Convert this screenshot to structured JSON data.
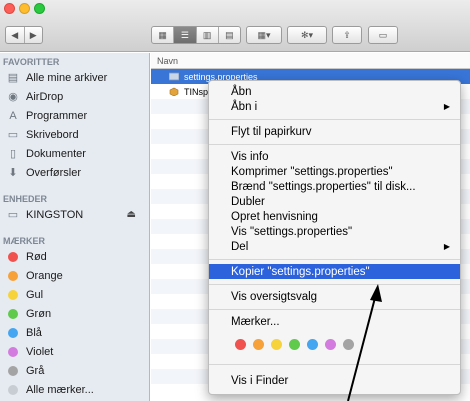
{
  "toolbar": {
    "back_icon": "◀",
    "forward_icon": "▶",
    "view_icons": [
      "▦",
      "☰",
      "▥",
      "▤"
    ],
    "arrange_icon": "▦▾",
    "action_icon": "✻▾",
    "share_icon": "⇪",
    "tag_icon": "▭"
  },
  "sidebar": {
    "favorites_header": "FAVORITTER",
    "favorites": [
      {
        "label": "Alle mine arkiver",
        "icon": "▤"
      },
      {
        "label": "AirDrop",
        "icon": "◉"
      },
      {
        "label": "Programmer",
        "icon": "A"
      },
      {
        "label": "Skrivebord",
        "icon": "▭"
      },
      {
        "label": "Dokumenter",
        "icon": "▯"
      },
      {
        "label": "Overførsler",
        "icon": "⬇"
      }
    ],
    "devices_header": "ENHEDER",
    "devices": [
      {
        "label": "KINGSTON",
        "icon": "▭",
        "eject": "⏏"
      }
    ],
    "tags_header": "MÆRKER",
    "tags": [
      {
        "label": "Rød",
        "color": "#f0524f"
      },
      {
        "label": "Orange",
        "color": "#f6a13a"
      },
      {
        "label": "Gul",
        "color": "#f7d33b"
      },
      {
        "label": "Grøn",
        "color": "#5fca4c"
      },
      {
        "label": "Blå",
        "color": "#44a5f0"
      },
      {
        "label": "Violet",
        "color": "#d47be0"
      },
      {
        "label": "Grå",
        "color": "#a4a4a4"
      },
      {
        "label": "Alle mærker...",
        "color": "#c8cdd3"
      }
    ]
  },
  "file_list": {
    "column_header": "Navn",
    "rows": [
      {
        "name": "settings.properties",
        "selected": true
      },
      {
        "name": "TINsp",
        "selected": false
      }
    ]
  },
  "context_menu": {
    "items": [
      {
        "label": "Åbn"
      },
      {
        "label": "Åbn i",
        "submenu": "▶"
      },
      {
        "label": "Flyt til papirkurv"
      },
      {
        "label": "Vis info"
      },
      {
        "label": "Komprimer \"settings.properties\""
      },
      {
        "label": "Brænd \"settings.properties\" til disk..."
      },
      {
        "label": "Dubler"
      },
      {
        "label": "Opret henvisning"
      },
      {
        "label": "Vis \"settings.properties\""
      },
      {
        "label": "Del",
        "submenu": "▶"
      },
      {
        "label": "Kopier \"settings.properties\"",
        "highlighted": true
      },
      {
        "label": "Vis oversigtsvalg"
      },
      {
        "label": "Mærker..."
      },
      {
        "label": "Vis i Finder"
      }
    ],
    "tag_colors": [
      "#f0524f",
      "#f6a13a",
      "#f7d33b",
      "#5fca4c",
      "#44a5f0",
      "#d47be0",
      "#a4a4a4"
    ]
  }
}
